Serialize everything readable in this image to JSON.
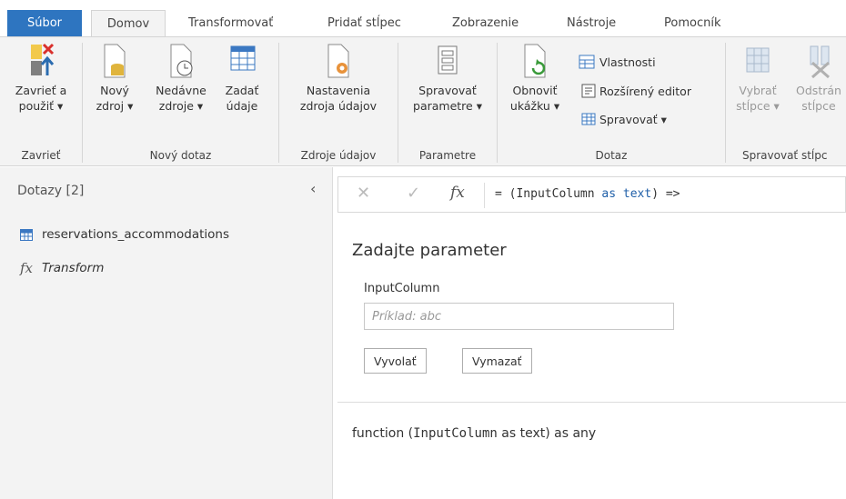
{
  "tabs": {
    "file": "Súbor",
    "home": "Domov",
    "transform": "Transformovať",
    "add_column": "Pridať stĺpec",
    "view": "Zobrazenie",
    "tools": "Nástroje",
    "help": "Pomocník"
  },
  "ribbon": {
    "close_apply": {
      "line1": "Zavrieť a",
      "line2": "použiť ▾"
    },
    "close_group": "Zavrieť",
    "new_source": {
      "line1": "Nový",
      "line2": "zdroj ▾"
    },
    "recent_sources": {
      "line1": "Nedávne",
      "line2": "zdroje ▾"
    },
    "enter_data": {
      "line1": "Zadať",
      "line2": "údaje"
    },
    "new_query_group": "Nový dotaz",
    "source_settings": {
      "line1": "Nastavenia",
      "line2": "zdroja údajov"
    },
    "data_sources_group": "Zdroje údajov",
    "manage_params": {
      "line1": "Spravovať",
      "line2": "parametre ▾"
    },
    "params_group": "Parametre",
    "refresh_preview": {
      "line1": "Obnoviť",
      "line2": "ukážku ▾"
    },
    "properties": "Vlastnosti",
    "advanced_editor": "Rozšírený editor",
    "manage": "Spravovať ▾",
    "query_group": "Dotaz",
    "choose_columns": {
      "line1": "Vybrať",
      "line2": "stĺpce ▾"
    },
    "remove_columns": {
      "line1": "Odstrán",
      "line2": "stĺpce"
    },
    "manage_columns_group": "Spravovať stĺpc"
  },
  "queries": {
    "header": "Dotazy [2]",
    "items": [
      {
        "name": "reservations_accommodations",
        "kind": "table"
      },
      {
        "name": "Transform",
        "kind": "function"
      }
    ]
  },
  "formula": {
    "prefix": "= (InputColumn ",
    "kw_as": "as",
    "space": " ",
    "kw_text": "text",
    "suffix": ") =>"
  },
  "parameter": {
    "title": "Zadajte parameter",
    "label": "InputColumn",
    "placeholder": "Príklad: abc",
    "invoke": "Vyvolať",
    "clear": "Vymazať"
  },
  "signature": {
    "start": "function (",
    "param": "InputColumn",
    "end": " as text) as any"
  }
}
